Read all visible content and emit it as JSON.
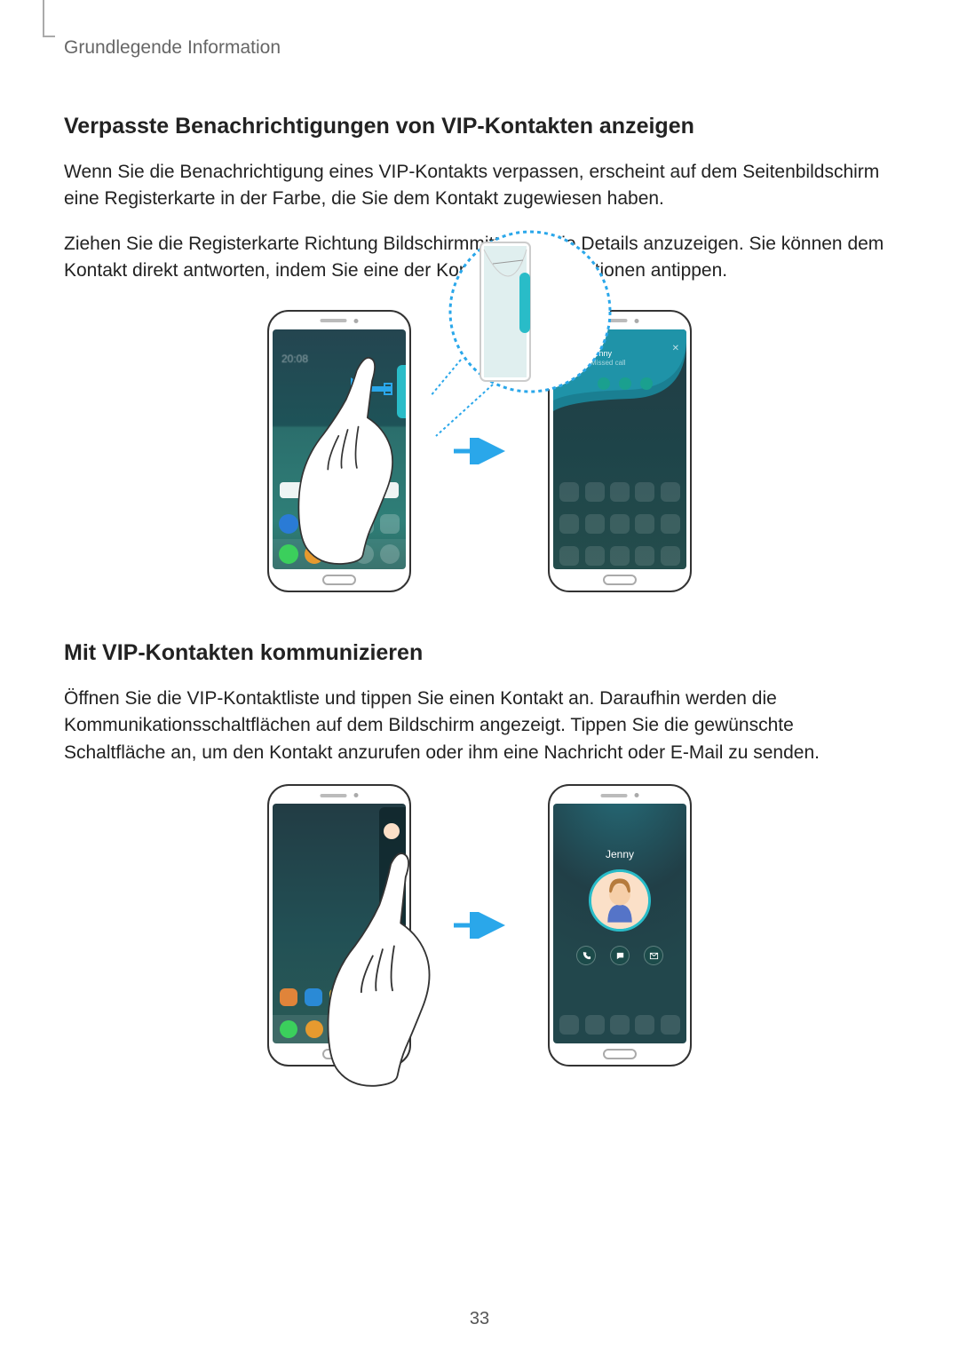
{
  "header": {
    "chapter": "Grundlegende Information"
  },
  "section1": {
    "title": "Verpasste Benachrichtigungen von VIP-Kontakten anzeigen",
    "p1": "Wenn Sie die Benachrichtigung eines VIP-Kontakts verpassen, erscheint auf dem Seitenbildschirm eine Registerkarte in der Farbe, die Sie dem Kontakt zugewiesen haben.",
    "p2": "Ziehen Sie die Registerkarte Richtung Bildschirmmitte, um die Details anzuzeigen. Sie können dem Kontakt direkt antworten, indem Sie eine der Kommunikationsoptionen antippen."
  },
  "section2": {
    "title": "Mit VIP-Kontakten kommunizieren",
    "p1": "Öffnen Sie die VIP-Kontaktliste und tippen Sie einen Kontakt an. Daraufhin werden die Kommunikationsschaltflächen auf dem Bildschirm angezeigt. Tippen Sie die gewünschte Schaltfläche an, um den Kontakt anzurufen oder ihm eine Nachricht oder E-Mail zu senden."
  },
  "figure1": {
    "left": {
      "time": "20:08"
    },
    "right": {
      "name": "Jenny",
      "sub": "Missed call",
      "close": "✕"
    }
  },
  "figure2": {
    "right": {
      "name": "Jenny"
    }
  },
  "icons": {
    "phone": "phone-icon",
    "message": "message-icon",
    "email": "email-icon",
    "arrow": "arrow-right-icon"
  },
  "page_number": "33"
}
